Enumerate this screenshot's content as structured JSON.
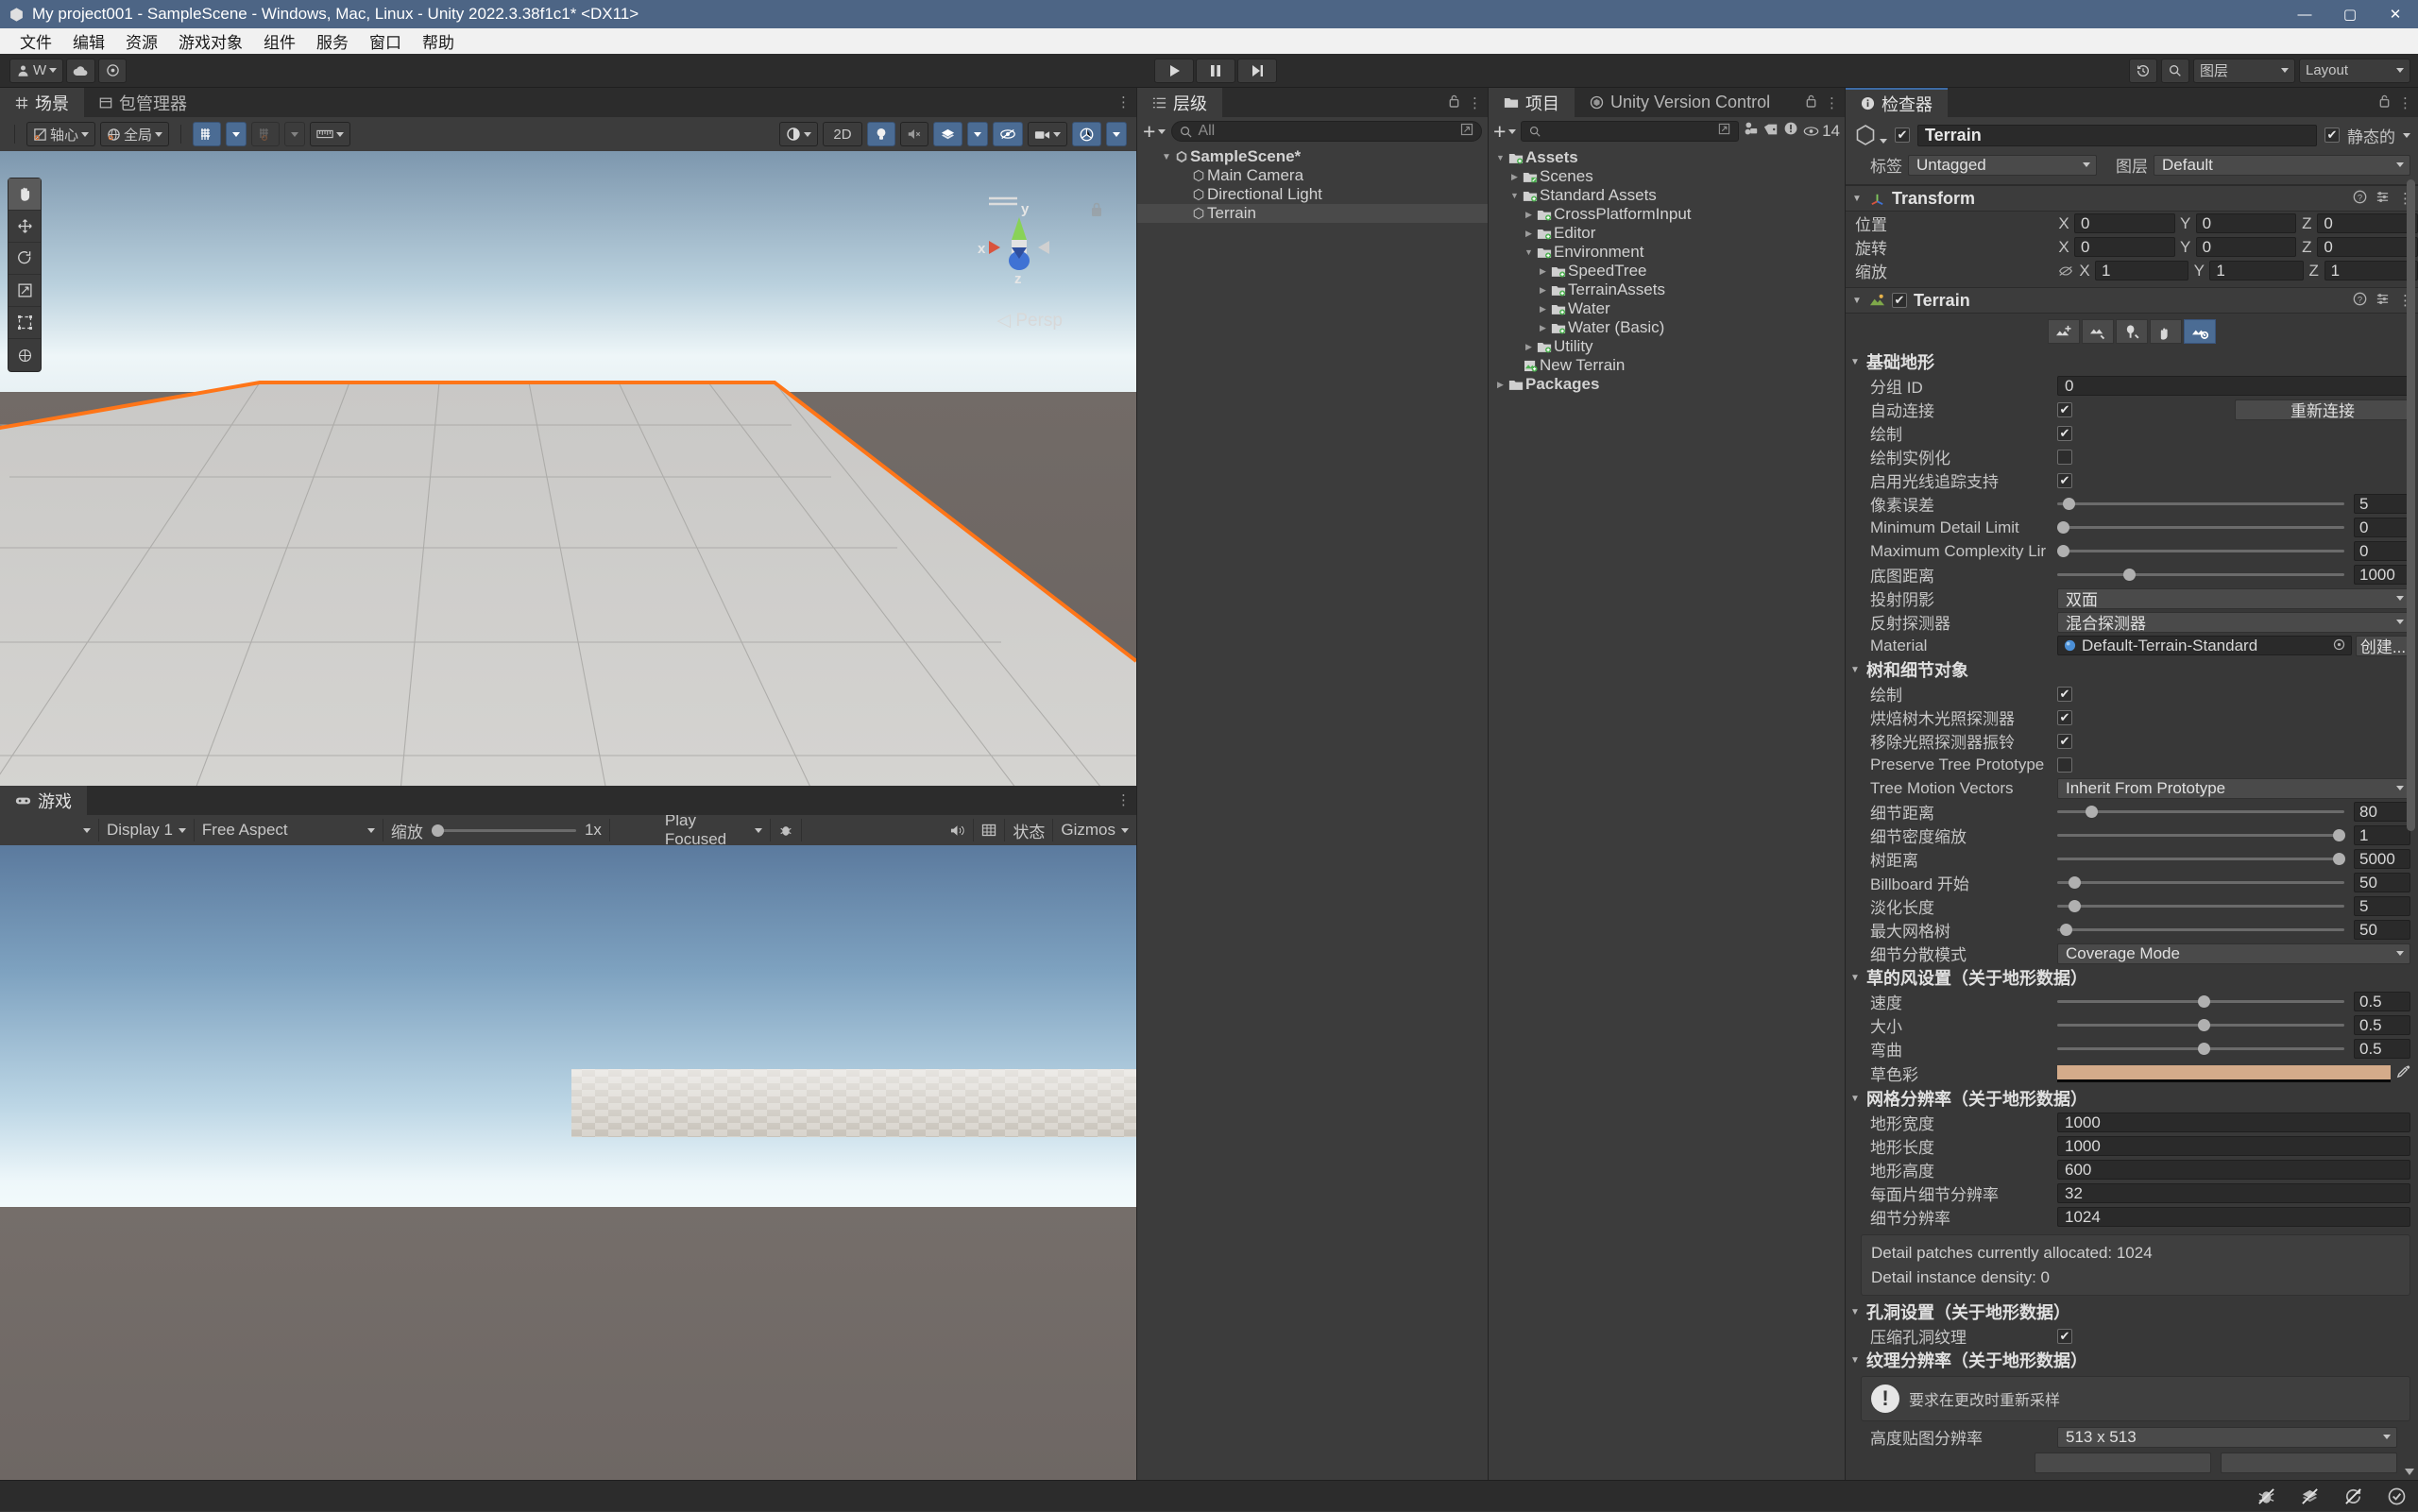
{
  "window": {
    "title": "My project001 - SampleScene - Windows, Mac, Linux - Unity 2022.3.38f1c1* <DX11>",
    "minimize": "—",
    "maximize": "▢",
    "close": "✕"
  },
  "menu": {
    "items": [
      "文件",
      "编辑",
      "资源",
      "游戏对象",
      "组件",
      "服务",
      "窗口",
      "帮助"
    ]
  },
  "toolbar": {
    "account_label": "W",
    "cloud_icon": "cloud-icon",
    "settings_icon": "gear-icon",
    "play": "▶",
    "pause": "❚❚",
    "step": "▶❘",
    "history_icon": "history-icon",
    "search_icon": "search-icon",
    "layers_label": "图层",
    "layout_label": "Layout"
  },
  "scene_panel": {
    "tabs": [
      {
        "label": "场景",
        "icon": "grid-icon",
        "active": true
      },
      {
        "label": "包管理器",
        "icon": "package-icon",
        "active": false
      }
    ],
    "pivot_label": "轴心",
    "global_label": "全局",
    "grid_snap_icon": "grid-snap-icon",
    "snap_increment_icon": "snap-increment-icon",
    "ruler_icon": "ruler-icon",
    "right_controls": [
      {
        "name": "shading-mode",
        "label": ""
      },
      {
        "name": "2d-toggle",
        "label": "2D"
      },
      {
        "name": "lighting-toggle",
        "label": ""
      },
      {
        "name": "audio-toggle",
        "label": ""
      },
      {
        "name": "effects-toggle",
        "label": ""
      },
      {
        "name": "hidden-objects-toggle",
        "label": ""
      },
      {
        "name": "camera-settings",
        "label": ""
      },
      {
        "name": "gizmos-toggle",
        "label": ""
      }
    ],
    "tools": [
      "hand-tool",
      "move-tool",
      "rotate-tool",
      "scale-tool",
      "rect-tool",
      "transform-tool"
    ],
    "gizmo_axes": {
      "x": "x",
      "y": "y",
      "z": "z"
    },
    "persp_label": "Persp",
    "selection_outline_color": "#ff7518"
  },
  "game_panel": {
    "tab_label": "游戏",
    "display": "Display 1",
    "aspect": "Free Aspect",
    "scale_label": "缩放",
    "scale_value": "1x",
    "play_focused": "Play Focused",
    "stats_label": "状态",
    "gizmos_label": "Gizmos",
    "mute_icon": "mute-audio-icon",
    "bug_icon": "bug-icon",
    "frame_icon": "frame-icon"
  },
  "hierarchy": {
    "tab_label": "层级",
    "add_label": "+",
    "search_placeholder": "All",
    "items": [
      {
        "label": "SampleScene*",
        "depth": 0,
        "icon": "unity-scene-icon",
        "expanded": true,
        "selected": false,
        "bold": true
      },
      {
        "label": "Main Camera",
        "depth": 1,
        "icon": "gameobject-icon",
        "expanded": null,
        "selected": false,
        "bold": false
      },
      {
        "label": "Directional Light",
        "depth": 1,
        "icon": "gameobject-icon",
        "expanded": null,
        "selected": false,
        "bold": false
      },
      {
        "label": "Terrain",
        "depth": 1,
        "icon": "gameobject-icon",
        "expanded": null,
        "selected": true,
        "bold": false
      }
    ]
  },
  "project": {
    "tabs": [
      {
        "label": "项目",
        "icon": "folder-icon",
        "active": true
      },
      {
        "label": "Unity Version Control",
        "icon": "version-control-icon",
        "active": false
      }
    ],
    "search_placeholder": "",
    "filter_icons": [
      "type-filter-icon",
      "label-filter-icon",
      "error-filter-icon"
    ],
    "visible_count": "14",
    "items": [
      {
        "label": "Assets",
        "depth": 0,
        "icon": "folder-asset-icon",
        "expanded": true,
        "bold": true
      },
      {
        "label": "Scenes",
        "depth": 1,
        "icon": "folder-scene-icon",
        "expanded": false,
        "bold": false
      },
      {
        "label": "Standard Assets",
        "depth": 1,
        "icon": "folder-asset-icon",
        "expanded": true,
        "bold": false
      },
      {
        "label": "CrossPlatformInput",
        "depth": 2,
        "icon": "folder-asset-icon",
        "expanded": false,
        "bold": false
      },
      {
        "label": "Editor",
        "depth": 2,
        "icon": "folder-asset-icon",
        "expanded": false,
        "bold": false
      },
      {
        "label": "Environment",
        "depth": 2,
        "icon": "folder-asset-icon",
        "expanded": true,
        "bold": false
      },
      {
        "label": "SpeedTree",
        "depth": 3,
        "icon": "folder-asset-icon",
        "expanded": false,
        "bold": false
      },
      {
        "label": "TerrainAssets",
        "depth": 3,
        "icon": "folder-asset-icon",
        "expanded": false,
        "bold": false
      },
      {
        "label": "Water",
        "depth": 3,
        "icon": "folder-asset-icon",
        "expanded": false,
        "bold": false
      },
      {
        "label": "Water (Basic)",
        "depth": 3,
        "icon": "folder-asset-icon",
        "expanded": false,
        "bold": false
      },
      {
        "label": "Utility",
        "depth": 2,
        "icon": "folder-asset-icon",
        "expanded": false,
        "bold": false
      },
      {
        "label": "New Terrain",
        "depth": 1,
        "icon": "terrain-asset-icon",
        "expanded": null,
        "bold": false
      },
      {
        "label": "Packages",
        "depth": 0,
        "icon": "folder-icon",
        "expanded": false,
        "bold": true
      }
    ]
  },
  "inspector": {
    "tab_label": "检查器",
    "object": {
      "enabled": true,
      "name": "Terrain",
      "static_label": "静态的",
      "static_checked": true,
      "tag_label": "标签",
      "tag_value": "Untagged",
      "layer_label": "图层",
      "layer_value": "Default"
    },
    "transform": {
      "title": "Transform",
      "rows": [
        {
          "label": "位置",
          "x": "0",
          "y": "0",
          "z": "0"
        },
        {
          "label": "旋转",
          "x": "0",
          "y": "0",
          "z": "0"
        },
        {
          "label": "缩放",
          "x": "1",
          "y": "1",
          "z": "1"
        }
      ]
    },
    "terrain": {
      "title": "Terrain",
      "enabled": true,
      "tool_buttons": [
        {
          "name": "create-neighbor-terrains-tool",
          "active": false
        },
        {
          "name": "paint-terrain-tool",
          "active": false
        },
        {
          "name": "paint-trees-tool",
          "active": false
        },
        {
          "name": "paint-details-tool",
          "active": false
        },
        {
          "name": "terrain-settings-tool",
          "active": true
        }
      ],
      "basic_terrain": {
        "title": "基础地形",
        "group_id_label": "分组 ID",
        "group_id_value": "0",
        "auto_connect_label": "自动连接",
        "auto_connect_checked": true,
        "reconnect_button": "重新连接",
        "draw_label": "绘制",
        "draw_checked": true,
        "draw_instanced_label": "绘制实例化",
        "draw_instanced_checked": false,
        "raytracing_label": "启用光线追踪支持",
        "raytracing_checked": true,
        "pixel_error_label": "像素误差",
        "pixel_error_value": "5",
        "pixel_error_pct": 2,
        "min_detail_label": "Minimum Detail Limit",
        "min_detail_value": "0",
        "min_detail_pct": 0,
        "max_complexity_label": "Maximum Complexity Lir",
        "max_complexity_value": "0",
        "max_complexity_pct": 0,
        "base_map_dist_label": "底图距离",
        "base_map_dist_value": "1000",
        "base_map_dist_pct": 23,
        "cast_shadows_label": "投射阴影",
        "cast_shadows_value": "双面",
        "reflection_probes_label": "反射探测器",
        "reflection_probes_value": "混合探测器",
        "material_label": "Material",
        "material_value": "Default-Terrain-Standard",
        "create_button": "创建..."
      },
      "tree_detail": {
        "title": "树和细节对象",
        "draw_label": "绘制",
        "draw_checked": true,
        "bake_light_probes_label": "烘焙树木光照探测器",
        "bake_light_probes_checked": true,
        "remove_ringing_label": "移除光照探测器振铃",
        "remove_ringing_checked": true,
        "preserve_proto_label": "Preserve Tree Prototype",
        "preserve_proto_checked": false,
        "motion_vectors_label": "Tree Motion Vectors",
        "motion_vectors_value": "Inherit From Prototype",
        "detail_distance_label": "细节距离",
        "detail_distance_value": "80",
        "detail_distance_pct": 10,
        "detail_density_label": "细节密度缩放",
        "detail_density_value": "1",
        "detail_density_pct": 97,
        "tree_distance_label": "树距离",
        "tree_distance_value": "5000",
        "tree_distance_pct": 97,
        "billboard_start_label": "Billboard 开始",
        "billboard_start_value": "50",
        "billboard_start_pct": 4,
        "fade_length_label": "淡化长度",
        "fade_length_value": "5",
        "fade_length_pct": 4,
        "max_mesh_trees_label": "最大网格树",
        "max_mesh_trees_value": "50",
        "max_mesh_trees_pct": 1,
        "detail_scatter_label": "细节分散模式",
        "detail_scatter_value": "Coverage Mode"
      },
      "grass_wind": {
        "title": "草的风设置（关于地形数据）",
        "speed_label": "速度",
        "speed_value": "0.5",
        "speed_pct": 50,
        "size_label": "大小",
        "size_value": "0.5",
        "size_pct": 50,
        "bending_label": "弯曲",
        "bending_value": "0.5",
        "bending_pct": 50,
        "grass_tint_label": "草色彩",
        "grass_tint_color": "#d4ab8a"
      },
      "mesh_resolution": {
        "title": "网格分辨率（关于地形数据）",
        "width_label": "地形宽度",
        "width_value": "1000",
        "length_label": "地形长度",
        "length_value": "1000",
        "height_label": "地形高度",
        "height_value": "600",
        "detail_res_per_patch_label": "每面片细节分辨率",
        "detail_res_per_patch_value": "32",
        "detail_res_label": "细节分辨率",
        "detail_res_value": "1024",
        "info_line1": "Detail patches currently allocated: 1024",
        "info_line2": "Detail instance density: 0"
      },
      "holes": {
        "title": "孔洞设置（关于地形数据）",
        "compress_label": "压缩孔洞纹理",
        "compress_checked": true
      },
      "texture_resolution": {
        "title": "纹理分辨率（关于地形数据）",
        "warning": "要求在更改时重新采样",
        "heightmap_label": "高度贴图分辨率",
        "heightmap_value": "513 x 513"
      }
    }
  },
  "statusbar": {
    "icons": [
      "bug-muted-icon",
      "layers-muted-icon",
      "refresh-muted-icon",
      "check-circle-icon"
    ]
  },
  "annotations": {
    "arrow_color": "#ee1111",
    "ellipse_color": "#ee1111",
    "arrow_target": "terrain-settings-tool",
    "ellipse_target": "terrain-width-length-fields"
  }
}
